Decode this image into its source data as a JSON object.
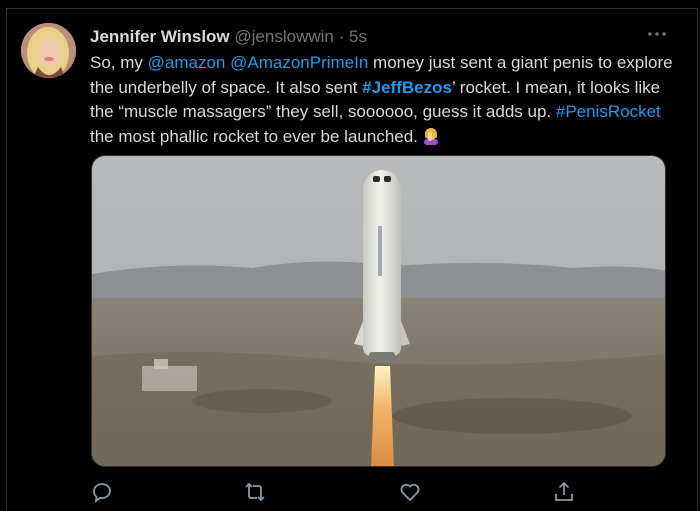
{
  "tweet": {
    "author_name": "Jennifer Winslow",
    "author_handle": "@jenslowwin",
    "separator": "·",
    "time": "5s",
    "text_parts": {
      "p1": "So, my ",
      "mention1": "@amazon",
      "p2": " ",
      "mention2": "@AmazonPrimeIn",
      "p3": " money just sent a giant penis to explore the underbelly of space. It also sent ",
      "hashtag1": "#JeffBezos",
      "p4": "’ rocket. I mean, it looks like the “muscle massagers” they sell, soooooo, guess it adds up. ",
      "hashtag2": "#PenisRocket",
      "p5": " the most phallic rocket to ever be launched."
    },
    "emoji": "woman-facepalming-emoji"
  },
  "colors": {
    "background": "#000000",
    "text": "#d9d9d9",
    "muted": "#6e767d",
    "link": "#1d9bf0",
    "border": "#2f3336"
  },
  "actions": [
    "reply-icon",
    "retweet-icon",
    "like-icon",
    "share-icon"
  ]
}
